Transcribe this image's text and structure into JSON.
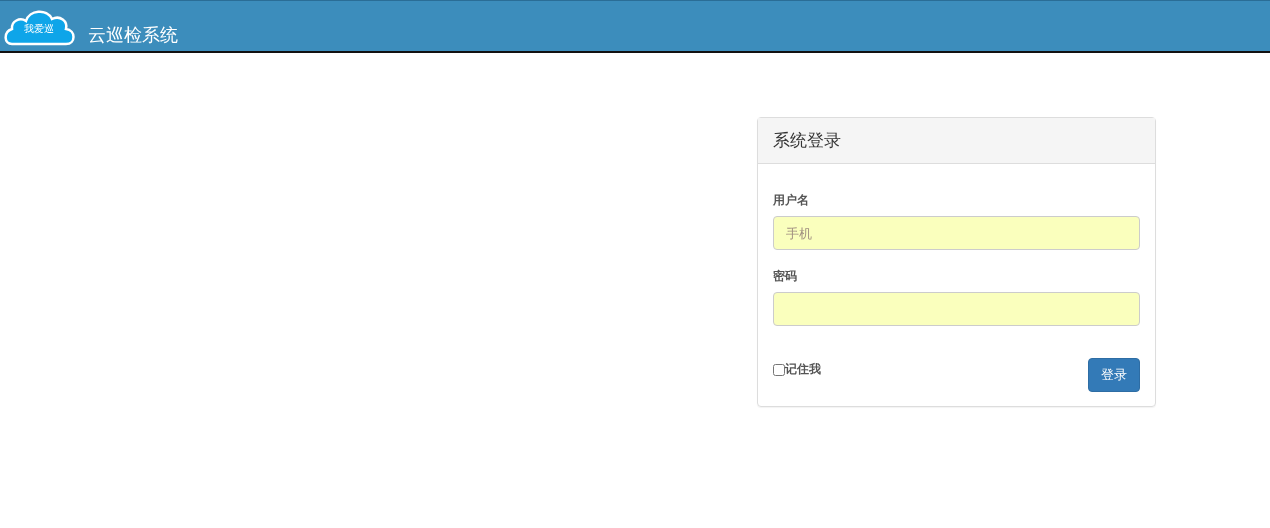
{
  "header": {
    "logo_text": "我爱巡",
    "title": "云巡检系统"
  },
  "login_panel": {
    "title": "系统登录",
    "fields": [
      {
        "label": "用户名",
        "placeholder": "手机"
      },
      {
        "label": "密码"
      }
    ],
    "remember": {
      "label": "记住我",
      "checked": false
    },
    "submit": "登录"
  }
}
